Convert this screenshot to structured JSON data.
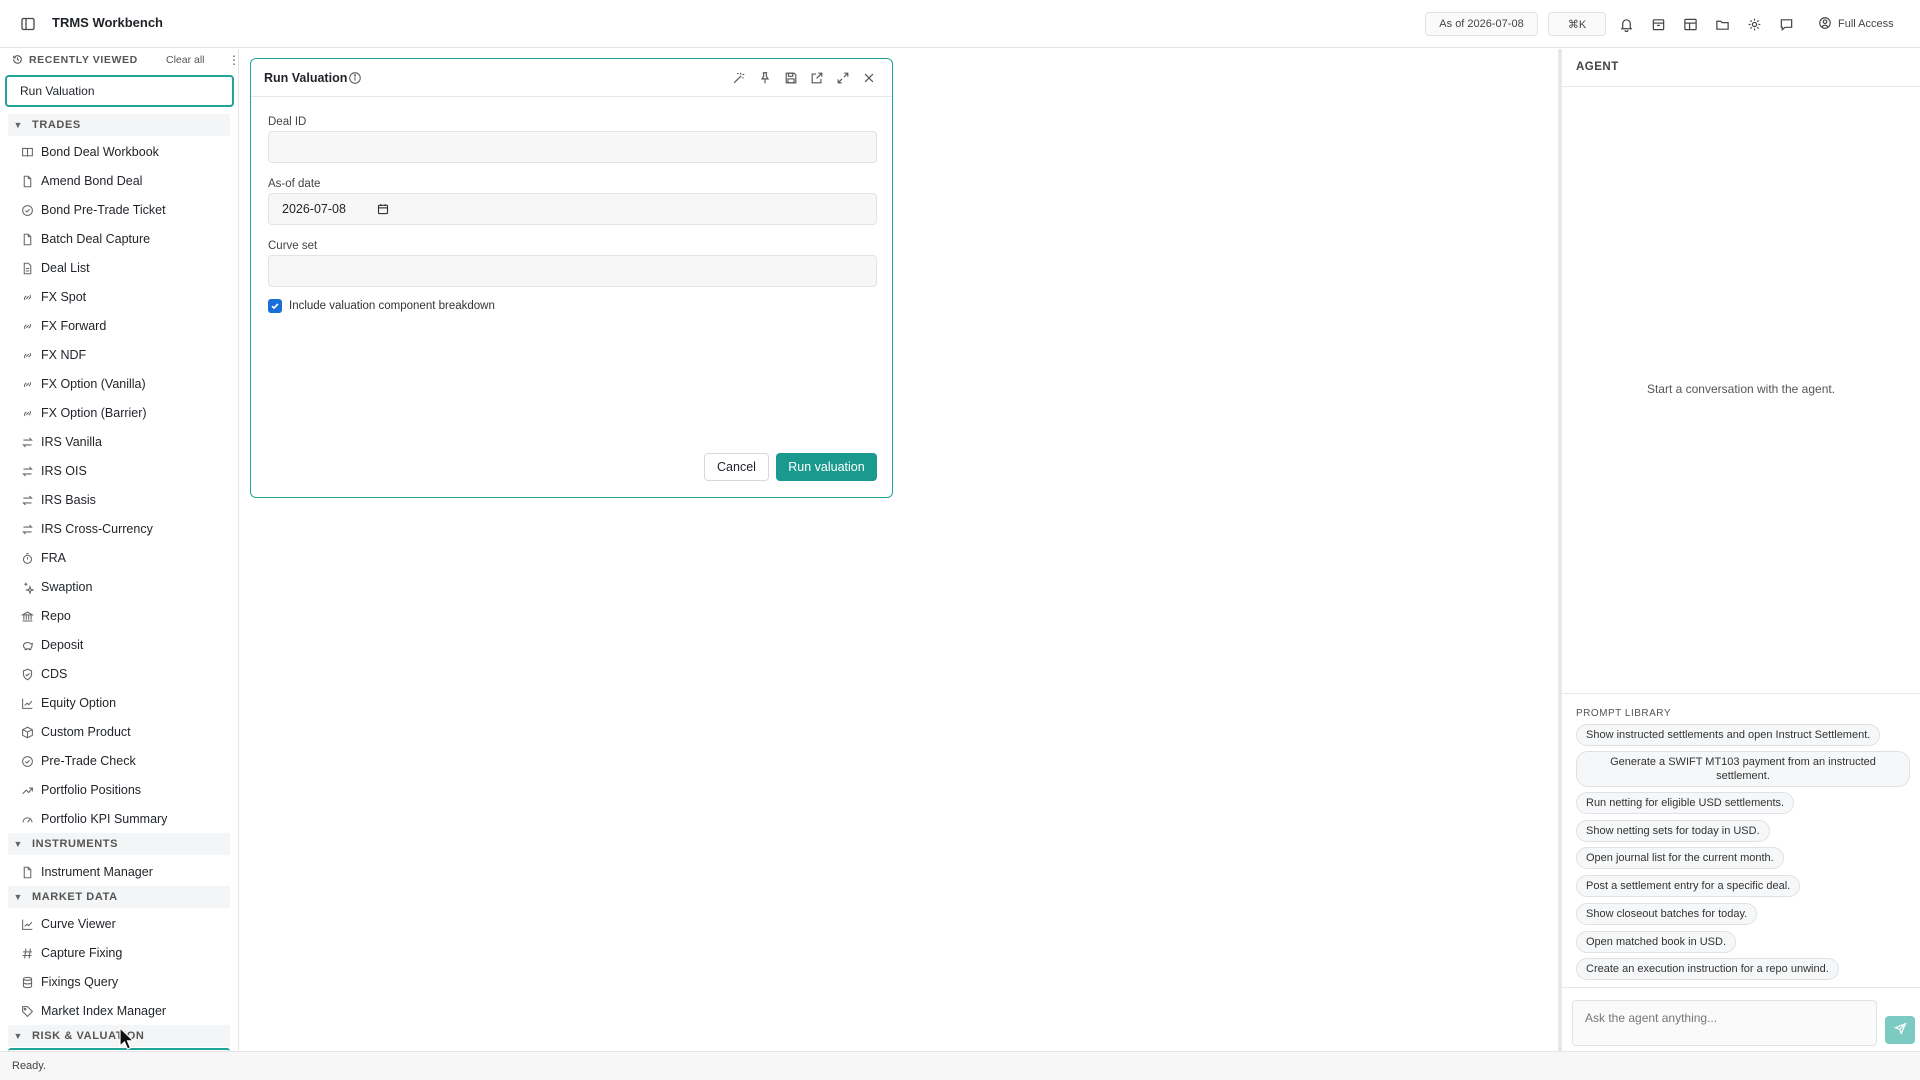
{
  "app": {
    "title": "TRMS Workbench"
  },
  "topbar": {
    "as_of": "As of 2026-07-08",
    "command_shortcut": "⌘K",
    "access_label": "Full Access",
    "icons": [
      "bell-icon",
      "archive-icon",
      "layout-icon",
      "folder-icon",
      "gear-icon",
      "chat-icon"
    ]
  },
  "sidebar": {
    "recently_viewed": {
      "title": "RECENTLY VIEWED",
      "clear_label": "Clear all",
      "items": [
        "Run Valuation"
      ]
    },
    "sections": [
      {
        "title": "TRADES",
        "items": [
          "Bond Deal Workbook",
          "Amend Bond Deal",
          "Bond Pre-Trade Ticket",
          "Batch Deal Capture",
          "Deal List",
          "FX Spot",
          "FX Forward",
          "FX NDF",
          "FX Option (Vanilla)",
          "FX Option (Barrier)",
          "IRS Vanilla",
          "IRS OIS",
          "IRS Basis",
          "IRS Cross-Currency",
          "FRA",
          "Swaption",
          "Repo",
          "Deposit",
          "CDS",
          "Equity Option",
          "Custom Product",
          "Pre-Trade Check",
          "Portfolio Positions",
          "Portfolio KPI Summary"
        ]
      },
      {
        "title": "INSTRUMENTS",
        "items": [
          "Instrument Manager"
        ]
      },
      {
        "title": "MARKET DATA",
        "items": [
          "Curve Viewer",
          "Capture Fixing",
          "Fixings Query",
          "Market Index Manager"
        ]
      },
      {
        "title": "RISK & VALUATION",
        "items": []
      }
    ]
  },
  "panel": {
    "title": "Run Valuation",
    "fields": {
      "deal_id": {
        "label": "Deal ID",
        "value": ""
      },
      "as_of_date": {
        "label": "As-of date",
        "value": "2026-07-08"
      },
      "curve_set": {
        "label": "Curve set",
        "value": ""
      }
    },
    "checkbox": {
      "label": "Include valuation component breakdown",
      "checked": true
    },
    "cancel_label": "Cancel",
    "run_label": "Run valuation"
  },
  "agent": {
    "title": "AGENT",
    "empty_state": "Start a conversation with the agent.",
    "prompt_library": {
      "title": "PROMPT LIBRARY",
      "items": [
        "Show instructed settlements and open Instruct Settlement.",
        "Generate a SWIFT MT103 payment from an instructed settlement.",
        "Run netting for eligible USD settlements.",
        "Show netting sets for today in USD.",
        "Open journal list for the current month.",
        "Post a settlement entry for a specific deal.",
        "Show closeout batches for today.",
        "Open matched book in USD.",
        "Create an execution instruction for a repo unwind."
      ]
    },
    "input_placeholder": "Ask the agent anything..."
  },
  "status": {
    "text": "Ready."
  },
  "colors": {
    "accent": "#21a39a",
    "primary_button": "#1a9a8e",
    "checkbox": "#1a6fd6"
  }
}
